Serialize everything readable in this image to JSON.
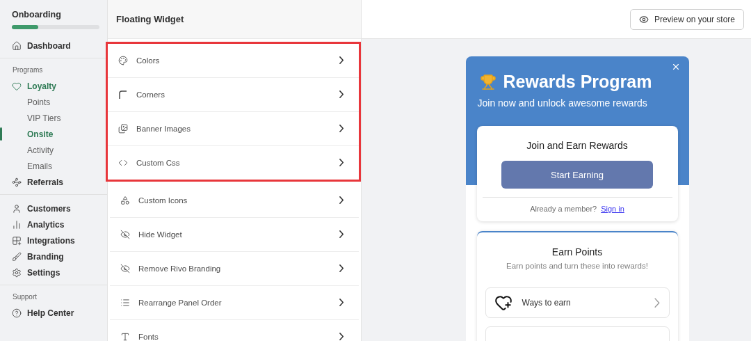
{
  "sidebar": {
    "onboarding": {
      "title": "Onboarding",
      "level": 0.3
    },
    "groups": [
      {
        "items": [
          {
            "label": "Dashboard",
            "selected": false
          }
        ]
      },
      {
        "label": "Programs",
        "items": [
          {
            "label": "Loyalty",
            "selected": false,
            "children": [
              {
                "label": "Points",
                "selected": false
              },
              {
                "label": "VIP Tiers",
                "selected": false
              },
              {
                "label": "Onsite",
                "selected": true
              },
              {
                "label": "Activity",
                "selected": false
              },
              {
                "label": "Emails",
                "selected": false
              }
            ]
          },
          {
            "label": "Referrals",
            "selected": false
          }
        ]
      },
      {
        "items": [
          {
            "label": "Customers",
            "selected": false
          },
          {
            "label": "Analytics",
            "selected": false
          },
          {
            "label": "Integrations",
            "selected": false
          },
          {
            "label": "Branding",
            "selected": false
          },
          {
            "label": "Settings",
            "selected": false
          }
        ]
      },
      {
        "label": "Support",
        "items": [
          {
            "label": "Help Center",
            "selected": false
          }
        ]
      }
    ]
  },
  "settings_panel": {
    "title": "Floating Widget",
    "items": [
      {
        "label": "Colors",
        "highlighted": true
      },
      {
        "label": "Corners",
        "highlighted": true
      },
      {
        "label": "Banner Images",
        "highlighted": true
      },
      {
        "label": "Custom Css",
        "highlighted": true
      },
      {
        "label": "Custom Icons",
        "highlighted": false
      },
      {
        "label": "Hide Widget",
        "highlighted": false
      },
      {
        "label": "Remove Rivo Branding",
        "highlighted": false
      },
      {
        "label": "Rearrange Panel Order",
        "highlighted": false
      },
      {
        "label": "Fonts",
        "highlighted": false
      }
    ]
  },
  "toolbar": {
    "preview_button": "Preview on your store"
  },
  "widget": {
    "title": "Rewards Program",
    "subtitle": "Join now and unlock awesome rewards",
    "join_card": {
      "title": "Join and Earn Rewards",
      "button": "Start Earning",
      "member_text": "Already a member?",
      "sign_in": "Sign in"
    },
    "earn_card": {
      "title": "Earn Points",
      "subtitle": "Earn points and turn these into rewards!",
      "rows": [
        {
          "label": "Ways to earn"
        }
      ]
    }
  }
}
